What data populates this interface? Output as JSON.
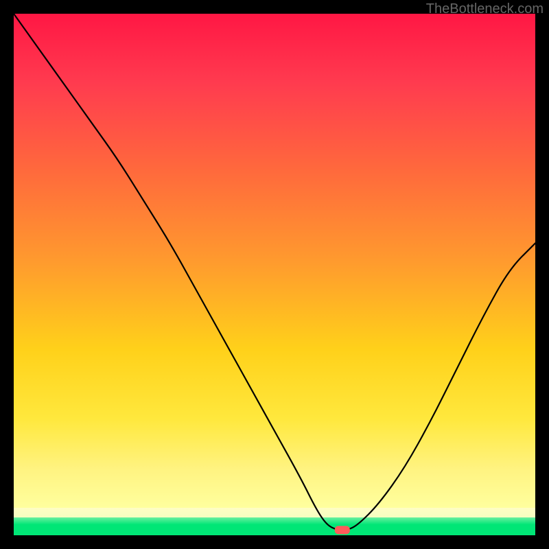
{
  "watermark": "TheBottleneck.com",
  "colors": {
    "frame": "#000000",
    "gradient_top": "#ff1744",
    "gradient_mid": "#ffd11a",
    "gradient_bottom": "#ffff9e",
    "band_pale": "#fffdc4",
    "band_green": "#00e676",
    "curve": "#000000",
    "marker": "#ff5a5a"
  },
  "chart_data": {
    "type": "line",
    "title": "",
    "xlabel": "",
    "ylabel": "",
    "xlim": [
      0,
      100
    ],
    "ylim": [
      0,
      100
    ],
    "x": [
      0,
      5,
      10,
      15,
      20,
      25,
      30,
      35,
      40,
      45,
      50,
      55,
      58,
      60,
      62,
      64,
      66,
      70,
      75,
      80,
      85,
      90,
      95,
      100
    ],
    "values": [
      100,
      93,
      86,
      79,
      72,
      64,
      56,
      47,
      38,
      29,
      20,
      11,
      5,
      2,
      1,
      1,
      2,
      6,
      13,
      22,
      32,
      42,
      51,
      56
    ],
    "marker": {
      "x": 63,
      "y": 1
    },
    "note": "y is percentage height from bottom (0) to top (100); curve descends from top-left, reaches ~0 near x≈62, rises on the right. Background encodes value: red (high) → yellow → green (near 0)."
  }
}
